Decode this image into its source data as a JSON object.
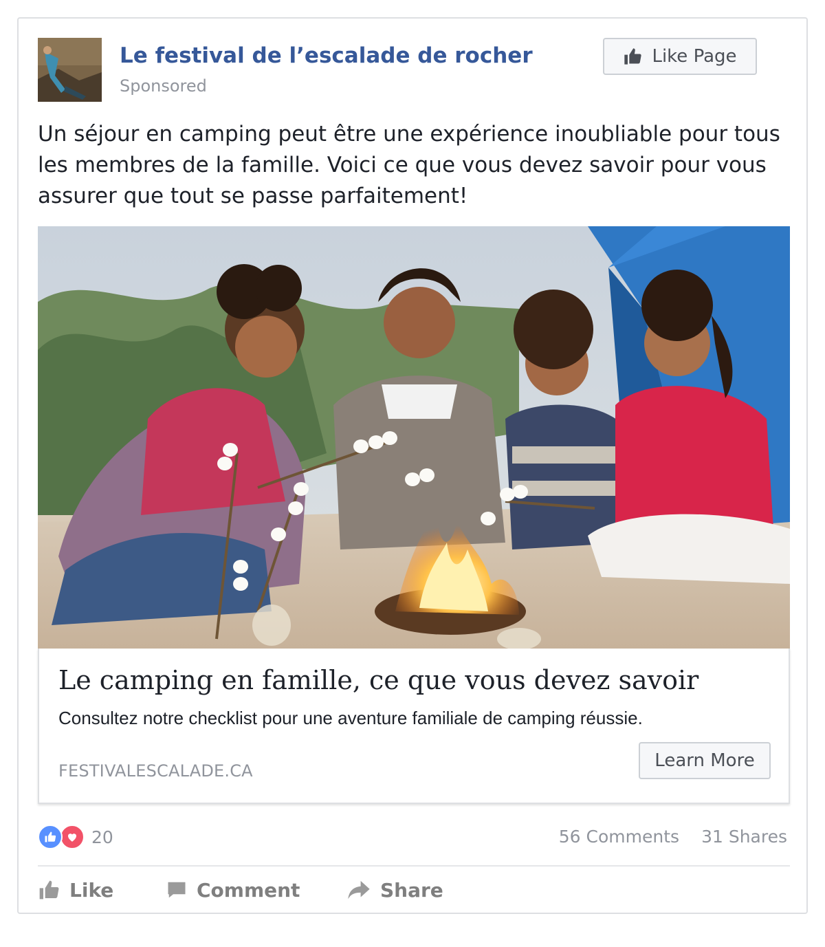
{
  "post": {
    "page_name": "Le festival de l’escalade de rocher",
    "sponsored_label": "Sponsored",
    "like_page_label": "Like Page",
    "text": "Un séjour en camping peut être une expérience inoubliable pour tous les membres de la famille. Voici ce que vous devez savoir pour vous assurer que tout se passe parfaitement!"
  },
  "link": {
    "title": "Le camping en famille, ce que vous devez savoir",
    "description": "Consultez notre checklist pour une aventure familiale de camping réussie.",
    "domain": "FESTIVALESCALADE.CA",
    "cta_label": "Learn More"
  },
  "stats": {
    "reaction_count": "20",
    "comments": "56 Comments",
    "shares": "31 Shares"
  },
  "actions": {
    "like": "Like",
    "comment": "Comment",
    "share": "Share"
  },
  "icons": {
    "like_page": "thumbs-up-icon",
    "reaction_like": "thumbs-up-icon",
    "reaction_love": "heart-icon",
    "action_like": "thumbs-up-icon",
    "action_comment": "speech-bubble-icon",
    "action_share": "share-arrow-icon"
  },
  "colors": {
    "link_blue": "#365899",
    "muted_gray": "#90949c",
    "like_reaction": "#5890ff",
    "love_reaction": "#f25268",
    "action_gray": "#7f7f7f"
  }
}
